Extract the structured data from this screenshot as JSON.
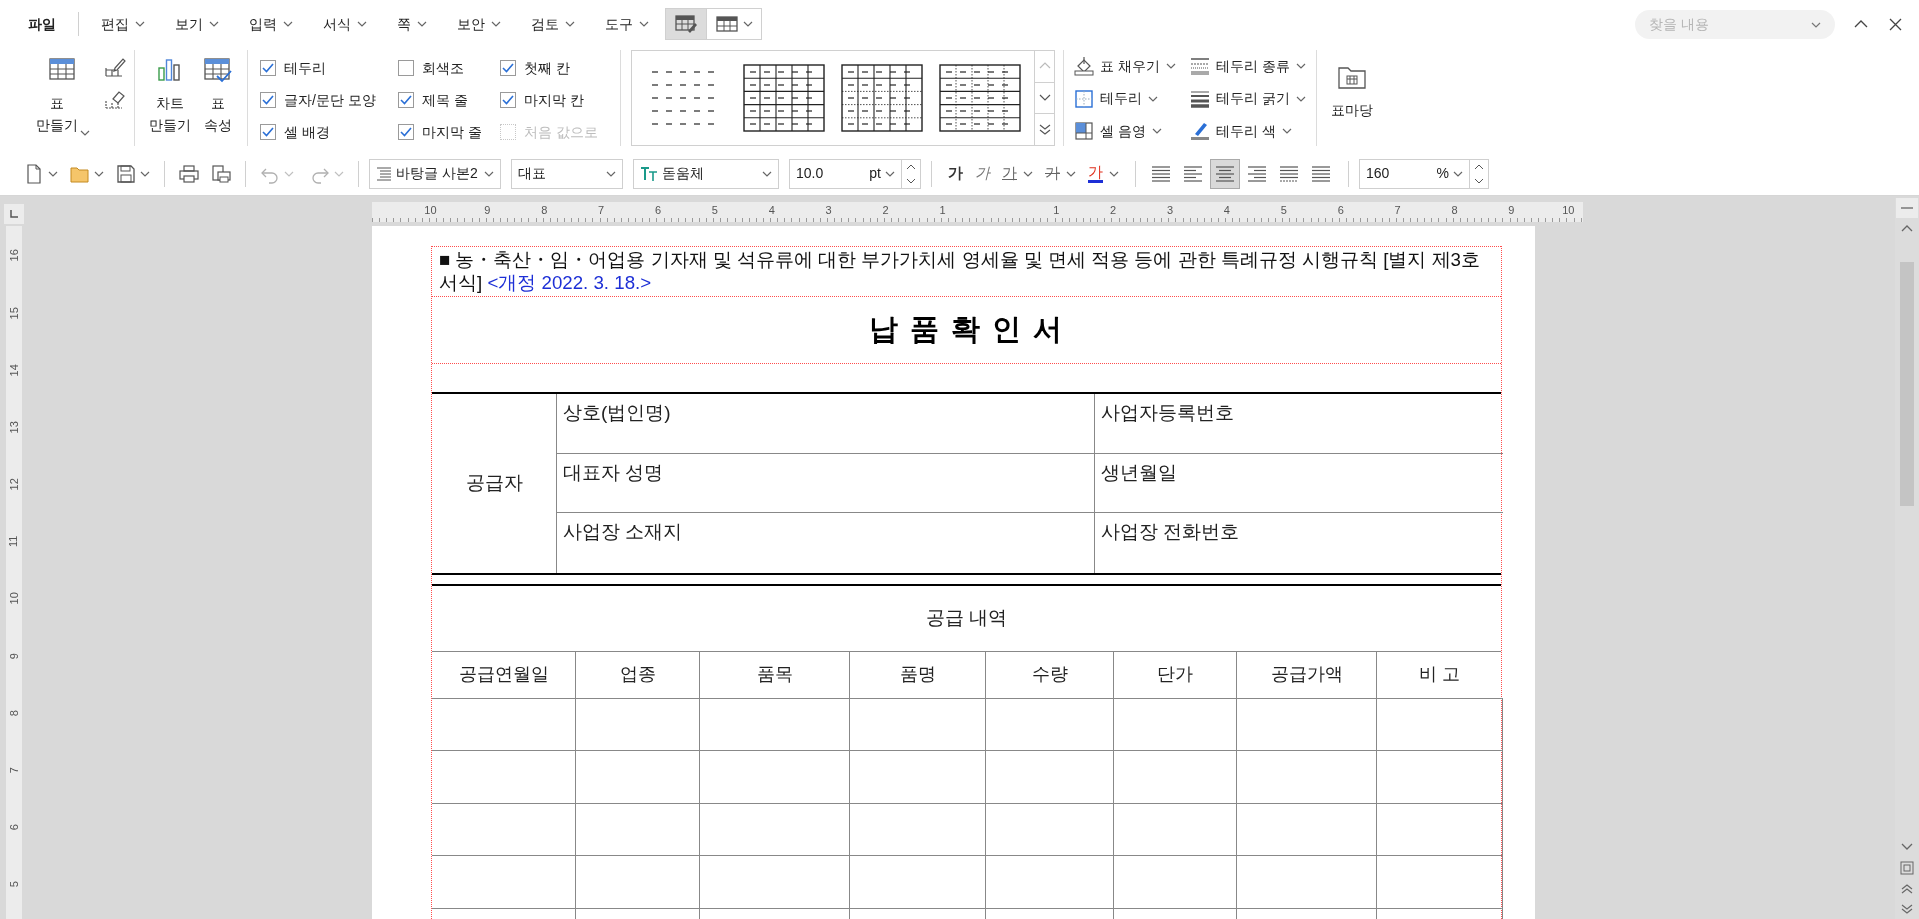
{
  "menu": {
    "items": [
      {
        "label": "파일",
        "kind": "file",
        "selected": false
      },
      {
        "label": "편집",
        "kind": "menu",
        "selected": false
      },
      {
        "label": "보기",
        "kind": "menu",
        "selected": false
      },
      {
        "label": "입력",
        "kind": "menu",
        "selected": false
      },
      {
        "label": "서식",
        "kind": "menu",
        "selected": false
      },
      {
        "label": "쪽",
        "kind": "menu",
        "selected": false
      },
      {
        "label": "보안",
        "kind": "menu",
        "selected": false
      },
      {
        "label": "검토",
        "kind": "menu",
        "selected": false
      },
      {
        "label": "도구",
        "kind": "menu",
        "selected": false
      }
    ],
    "context_tabs": [
      {
        "kind": "table-design",
        "selected": true
      },
      {
        "kind": "table-layout",
        "selected": false
      }
    ]
  },
  "search": {
    "placeholder": "찾을 내용"
  },
  "ribbon": {
    "make_buttons": [
      {
        "label": "표\n만들기",
        "kind": "table"
      },
      {
        "label": "차트\n만들기",
        "kind": "chart"
      },
      {
        "label": "표\n속성",
        "kind": "properties"
      }
    ],
    "options": [
      {
        "label": "테두리",
        "checked": true,
        "disabled": false
      },
      {
        "label": "글자/문단 모양",
        "checked": true,
        "disabled": false
      },
      {
        "label": "셀 배경",
        "checked": true,
        "disabled": false
      },
      {
        "label": "회색조",
        "checked": false,
        "disabled": false
      },
      {
        "label": "제목 줄",
        "checked": true,
        "disabled": false
      },
      {
        "label": "마지막 줄",
        "checked": true,
        "disabled": false
      },
      {
        "label": "첫째 칸",
        "checked": true,
        "disabled": false
      },
      {
        "label": "마지막 칸",
        "checked": true,
        "disabled": false
      },
      {
        "label": "처음 값으로",
        "checked": false,
        "disabled": true
      }
    ],
    "tools": [
      {
        "label": "표 채우기",
        "kind": "fill"
      },
      {
        "label": "테두리",
        "kind": "border"
      },
      {
        "label": "셀 음영",
        "kind": "shade"
      },
      {
        "label": "테두리 종류",
        "kind": "border-type"
      },
      {
        "label": "테두리 굵기",
        "kind": "border-width"
      },
      {
        "label": "테두리 색",
        "kind": "border-color"
      }
    ],
    "library": {
      "label": "표마당"
    }
  },
  "toolbar": {
    "history": [
      {
        "kind": "undo",
        "disabled": true
      },
      {
        "kind": "redo",
        "disabled": true
      }
    ],
    "paragraph_style": "바탕글 사본2",
    "language": "대표",
    "font": "돋움체",
    "size": "10.0",
    "size_unit": "pt",
    "char_formats": [
      {
        "label": "가",
        "kind": "bold"
      },
      {
        "label": "가",
        "kind": "italic"
      },
      {
        "label": "가",
        "kind": "underline"
      },
      {
        "label": "가",
        "kind": "strike"
      },
      {
        "label": "가",
        "kind": "color"
      }
    ],
    "alignments": [
      {
        "kind": "justify",
        "selected": false
      },
      {
        "kind": "left",
        "selected": false
      },
      {
        "kind": "center",
        "selected": true
      },
      {
        "kind": "right",
        "selected": false
      },
      {
        "kind": "distribute",
        "selected": false
      },
      {
        "kind": "divide",
        "selected": false
      }
    ],
    "zoom": "160",
    "zoom_unit": "%"
  },
  "ruler": {
    "horizontal": [
      "10",
      "9",
      "8",
      "7",
      "6",
      "5",
      "4",
      "3",
      "2",
      "1",
      "1",
      "2",
      "3",
      "4",
      "5",
      "6",
      "7",
      "8",
      "9",
      "10"
    ],
    "vertical": [
      "16",
      "15",
      "14",
      "13",
      "12",
      "11",
      "10",
      "9",
      "8",
      "7",
      "6",
      "5"
    ]
  },
  "document": {
    "form_reference": "■ 농・축산・임・어업용 기자재 및 석유류에 대한 부가가치세 영세율 및 면세 적용 등에 관한 특례규정 시행규칙 [별지 제3호 서식]",
    "revision": "<개정 2022. 3. 18.>",
    "title": "납 품 확 인 서",
    "supplier": {
      "label": "공급자",
      "fields": [
        [
          "상호(법인명)",
          "사업자등록번호"
        ],
        [
          "대표자 성명",
          "생년월일"
        ],
        [
          "사업장 소재지",
          "사업장 전화번호"
        ]
      ]
    },
    "supply": {
      "heading": "공급 내역",
      "columns": [
        "공급연월일",
        "업종",
        "품목",
        "품명",
        "수량",
        "단가",
        "공급가액",
        "비 고"
      ]
    }
  }
}
